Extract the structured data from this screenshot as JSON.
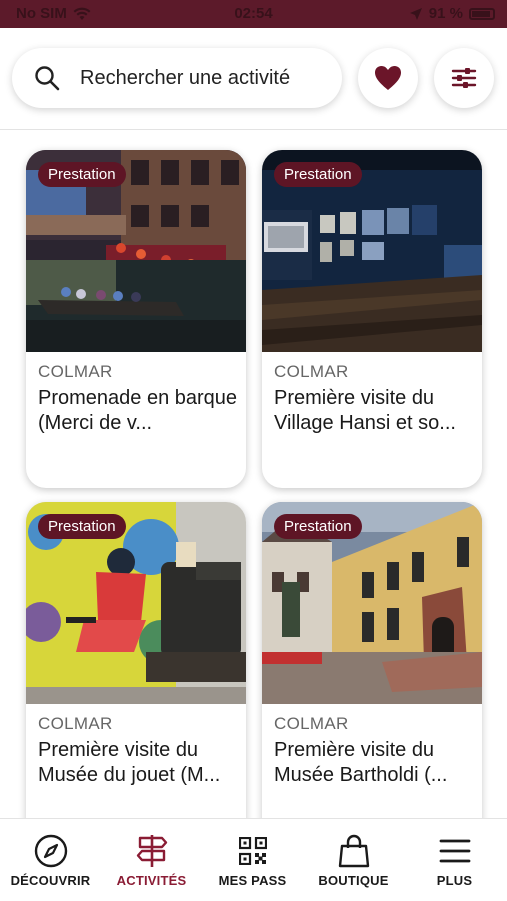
{
  "status_bar": {
    "carrier": "No SIM",
    "time": "02:54",
    "battery": "91 %"
  },
  "search": {
    "placeholder": "Rechercher une activité"
  },
  "colors": {
    "accent": "#8a1c34",
    "badge": "#5e1525",
    "status_bar": "#5c1a2a"
  },
  "cards": [
    {
      "badge": "Prestation",
      "city": "COLMAR",
      "title": "Promenade en barque (Merci de v..."
    },
    {
      "badge": "Prestation",
      "city": "COLMAR",
      "title": "Première visite du Village Hansi et so..."
    },
    {
      "badge": "Prestation",
      "city": "COLMAR",
      "title": "Première visite du Musée du jouet (M..."
    },
    {
      "badge": "Prestation",
      "city": "COLMAR",
      "title": "Première visite du Musée Bartholdi (..."
    }
  ],
  "tabs": [
    {
      "label": "DÉCOUVRIR",
      "icon": "compass-icon",
      "active": false
    },
    {
      "label": "ACTIVITÉS",
      "icon": "signpost-icon",
      "active": true
    },
    {
      "label": "MES PASS",
      "icon": "qr-code-icon",
      "active": false
    },
    {
      "label": "BOUTIQUE",
      "icon": "shopping-bag-icon",
      "active": false
    },
    {
      "label": "PLUS",
      "icon": "menu-icon",
      "active": false
    }
  ]
}
